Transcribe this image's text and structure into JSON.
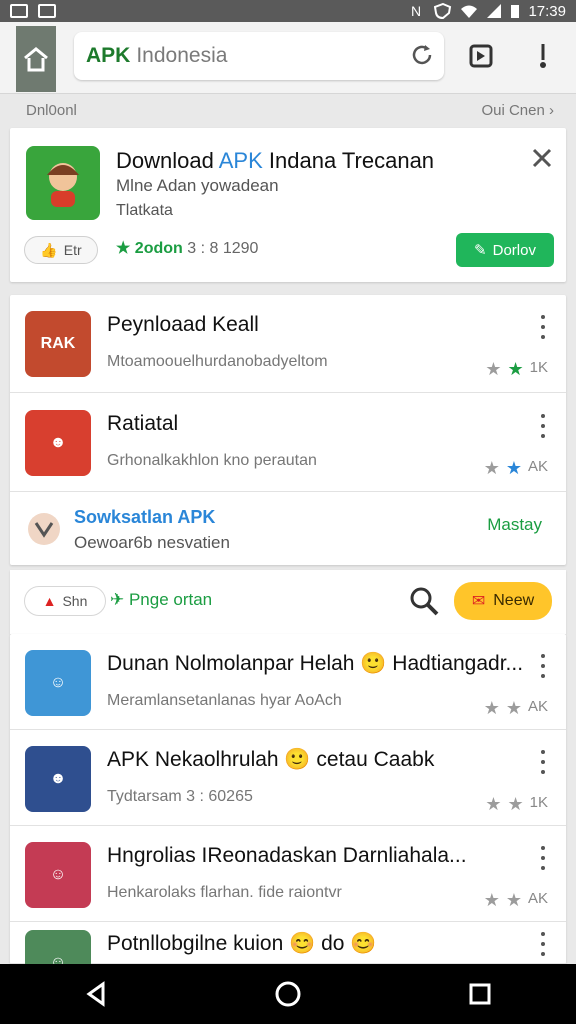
{
  "status_bar": {
    "time": "17:39"
  },
  "browser": {
    "url_strong": "APK",
    "url_light": "Indonesia"
  },
  "breadcrumb": {
    "left": "Dnl0onl",
    "right": "Oui Cnen"
  },
  "banner": {
    "title_prefix": "Download",
    "title_apk": "APK",
    "title_suffix": "Indana Trecanan",
    "subtitle_1": "Mlne Adan yowadean",
    "subtitle_2": "Tlatkata",
    "pill_label": "Etr",
    "rating_label": "2odon",
    "rating_number": "3 : 8 1290",
    "download_label": "Dorlov"
  },
  "featured": [
    {
      "title": "Peynloaad Keall",
      "subtitle": "Mtoamoouelhurdanobadyeltom",
      "stars_text": "1K",
      "icon": "rak-icon",
      "icon_color": "#c24a2e"
    },
    {
      "title": "Ratiatal",
      "subtitle": "Grhonalkakhlon kno perautan",
      "stars_text": "AK",
      "icon": "hat-man-icon",
      "icon_color": "#d83f2f"
    }
  ],
  "promo": {
    "title": "Sowksatlan APK",
    "subtitle": "Oewoar6b nesvatien",
    "action": "Mastay"
  },
  "filter": {
    "pill_label": "Shn",
    "text": "✈ Pnge ortan",
    "new_label": "Neew"
  },
  "apps": [
    {
      "title": "Dunan Nolmolanpar Helah 🙂 Hadtiangadr...",
      "subtitle": "Meramlansetanlanas hyar AoAch",
      "stars_text": "AK",
      "icon_color": "#3f96d6"
    },
    {
      "title": "APK Nekaolhrulah 🙂 cetau Caabk",
      "subtitle": "Tydtarsam 3 : 60265",
      "stars_text": "1K",
      "icon_color": "#2f4f8f"
    },
    {
      "title": "Hngrolias IReonadaskan Darnliahala...",
      "subtitle": "Henkarolaks flarhan. fide raiontvr",
      "stars_text": "AK",
      "icon_color": "#c43b54"
    },
    {
      "title": "Potnllobgilne kuion 😊 do 😊",
      "subtitle": "",
      "stars_text": "",
      "icon_color": "#4e8a5a"
    }
  ]
}
